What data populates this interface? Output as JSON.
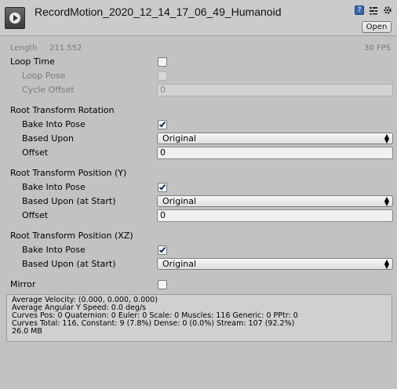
{
  "header": {
    "title": "RecordMotion_2020_12_14_17_06_49_Humanoid",
    "open_label": "Open",
    "help_glyph": "?",
    "icons": [
      "animation-clip-icon",
      "help-icon",
      "preset-icon",
      "gear-icon"
    ]
  },
  "info": {
    "length_label": "Length",
    "length_value": "211.552",
    "fps": "30 FPS"
  },
  "loop": {
    "loop_time_label": "Loop Time",
    "loop_time_checked": false,
    "loop_pose_label": "Loop Pose",
    "loop_pose_checked": false,
    "cycle_offset_label": "Cycle Offset",
    "cycle_offset_value": "0"
  },
  "rotation": {
    "heading": "Root Transform Rotation",
    "bake_label": "Bake Into Pose",
    "bake_checked": true,
    "based_upon_label": "Based Upon",
    "based_upon_value": "Original",
    "offset_label": "Offset",
    "offset_value": "0"
  },
  "position_y": {
    "heading": "Root Transform Position (Y)",
    "bake_label": "Bake Into Pose",
    "bake_checked": true,
    "based_upon_label": "Based Upon (at Start)",
    "based_upon_value": "Original",
    "offset_label": "Offset",
    "offset_value": "0"
  },
  "position_xz": {
    "heading": "Root Transform Position (XZ)",
    "bake_label": "Bake Into Pose",
    "bake_checked": true,
    "based_upon_label": "Based Upon (at Start)",
    "based_upon_value": "Original"
  },
  "mirror": {
    "label": "Mirror",
    "checked": false
  },
  "stats": {
    "lines": [
      "Average Velocity: (0.000, 0.000, 0.000)",
      "Average Angular Y Speed: 0.0 deg/s",
      "Curves Pos: 0 Quaternion: 0 Euler: 0 Scale: 0 Muscles: 116 Generic: 0 PPtr: 0",
      "Curves Total: 116, Constant: 9 (7.8%) Dense: 0 (0.0%) Stream: 107 (92.2%)",
      "26.0 MB"
    ]
  },
  "colors": {
    "background": "#c2c2c2",
    "header": "#cbcbcb",
    "checkmark": "#1b2f5a",
    "help_icon": "#3b66b0"
  }
}
